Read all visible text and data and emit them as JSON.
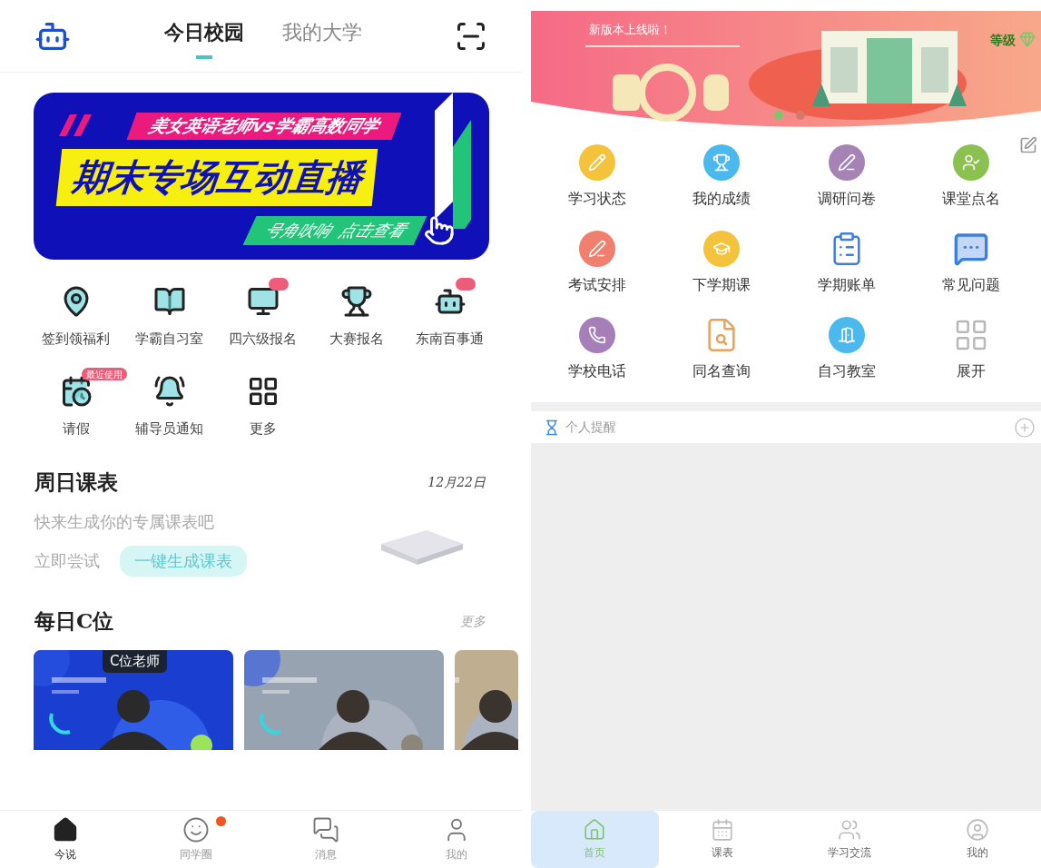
{
  "left_screen": {
    "header": {
      "tabs": [
        {
          "label": "今日校园",
          "selected": true
        },
        {
          "label": "我的大学",
          "selected": false
        }
      ]
    },
    "banner": {
      "subtitle": "美女英语老师vs学霸高数同学",
      "title": "期末专场互动直播",
      "cta": "号角吹响  点击查看"
    },
    "shortcuts": [
      {
        "label": "签到领福利",
        "flag": false
      },
      {
        "label": "学霸自习室",
        "flag": false
      },
      {
        "label": "四六级报名",
        "flag": true
      },
      {
        "label": "大赛报名",
        "flag": false
      },
      {
        "label": "东南百事通",
        "flag": true
      },
      {
        "label": "请假",
        "flag": true,
        "badge": "最近使用"
      },
      {
        "label": "辅导员通知",
        "flag": false
      },
      {
        "label": "更多",
        "flag": false
      }
    ],
    "schedule": {
      "title": "周日课表",
      "date": "12月22日",
      "hint": "快来生成你的专属课表吧",
      "prompt": "立即尝试",
      "button": "一键生成课表"
    },
    "featured": {
      "title": "每日C位",
      "more": "更多",
      "cards": [
        {
          "kind": "picture",
          "tag": "C位老师"
        },
        {
          "kind": "picture"
        },
        {
          "kind": "picture"
        }
      ]
    },
    "nav": [
      {
        "label": "今说",
        "selected": true,
        "dot": false
      },
      {
        "label": "同学圈",
        "selected": false,
        "dot": true
      },
      {
        "label": "消息",
        "selected": false,
        "dot": false
      },
      {
        "label": "我的",
        "selected": false,
        "dot": false
      }
    ]
  },
  "right_screen": {
    "banner": {
      "headline": "新版本上线啦！",
      "level": "等级",
      "dots": [
        {
          "selected": true
        },
        {
          "selected": false
        }
      ]
    },
    "apps": [
      {
        "label": "学习状态",
        "kind": "circle",
        "color": "#f5c33b"
      },
      {
        "label": "我的成绩",
        "kind": "circle",
        "color": "#4bb8ee"
      },
      {
        "label": "调研问卷",
        "kind": "circle",
        "color": "#a683b5"
      },
      {
        "label": "课堂点名",
        "kind": "circle",
        "color": "#8cc152"
      },
      {
        "label": "考试安排",
        "kind": "circle",
        "color": "#f07f6f"
      },
      {
        "label": "下学期课",
        "kind": "circle",
        "color": "#f5c33b"
      },
      {
        "label": "学期账单",
        "kind": "outline",
        "color": "#3b7fe0"
      },
      {
        "label": "常见问题",
        "kind": "solid",
        "color": "#3b7fe0"
      },
      {
        "label": "学校电话",
        "kind": "circle",
        "color": "#a67fb8"
      },
      {
        "label": "同名查询",
        "kind": "outline",
        "color": "#e8a25a"
      },
      {
        "label": "自习教室",
        "kind": "circle",
        "color": "#4bb8ee"
      },
      {
        "label": "展开",
        "kind": "outline",
        "color": "#b8b8b8"
      }
    ],
    "reminder": {
      "title": "个人提醒"
    },
    "nav": [
      {
        "label": "首页",
        "selected": true
      },
      {
        "label": "课表",
        "selected": false
      },
      {
        "label": "学习交流",
        "selected": false
      },
      {
        "label": "我的",
        "selected": false
      }
    ]
  }
}
